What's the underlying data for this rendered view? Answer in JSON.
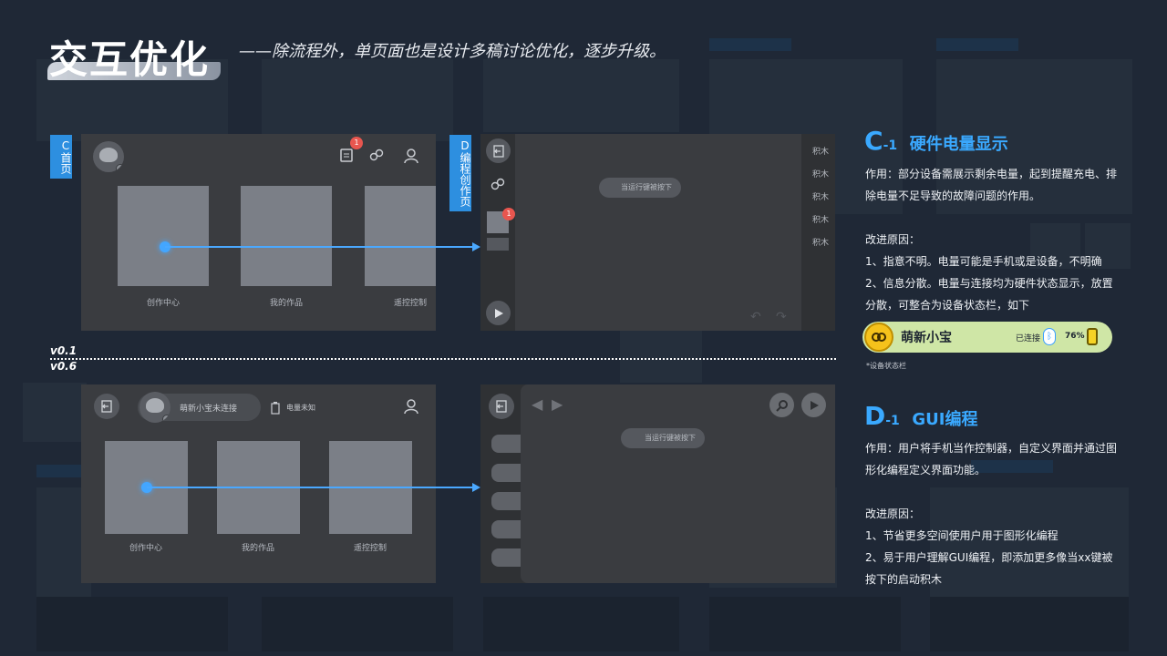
{
  "title": "交互优化",
  "subtitle": "——除流程外，单页面也是设计多稿讨论优化，逐步升级。",
  "versions": {
    "top": "v0.1",
    "bottom": "v0.6"
  },
  "tags": {
    "c_home": "C首页",
    "d_edit": "D编程创作页"
  },
  "home_v01": {
    "notification_count": "1",
    "cards": [
      "创作中心",
      "我的作品",
      "遥控控制"
    ]
  },
  "edit_v01": {
    "notification_count": "1",
    "pill": "当运行键被按下",
    "blocks": [
      "积木",
      "积木",
      "积木",
      "积木",
      "积木"
    ]
  },
  "home_v06": {
    "device_status": "萌新小宝未连接",
    "battery_status": "电量未知",
    "cards": [
      "创作中心",
      "我的作品",
      "遥控控制"
    ]
  },
  "edit_v06": {
    "pill": "当运行键被按下"
  },
  "section_c": {
    "letter": "C",
    "number": "-1",
    "name": "硬件电量显示",
    "purpose": "作用：部分设备需展示剩余电量，起到提醒充电、排除电量不足导致的故障问题的作用。",
    "reason_title": "改进原因：",
    "reason_1": "1、指意不明。电量可能是手机或是设备，不明确",
    "reason_2": "2、信息分散。电量与连接均为硬件状态显示，放置分散，可整合为设备状态栏，如下",
    "status_bar": {
      "name": "萌新小宝",
      "connection": "已连接",
      "battery": "76%"
    },
    "caption": "*设备状态栏"
  },
  "section_d": {
    "letter": "D",
    "number": "-1",
    "name": "GUI编程",
    "purpose": "作用：用户将手机当作控制器，自定义界面并通过图形化编程定义界面功能。",
    "reason_title": "改进原因：",
    "reason_1": "1、节省更多空间使用户用于图形化编程",
    "reason_2": "2、易于用户理解GUI编程，即添加更多像当xx键被按下的启动积木"
  },
  "colors": {
    "accent": "#3aa9ff",
    "tag": "#2d8fe0",
    "badge": "#e8564f",
    "status_bar": "#cfe6a6"
  }
}
